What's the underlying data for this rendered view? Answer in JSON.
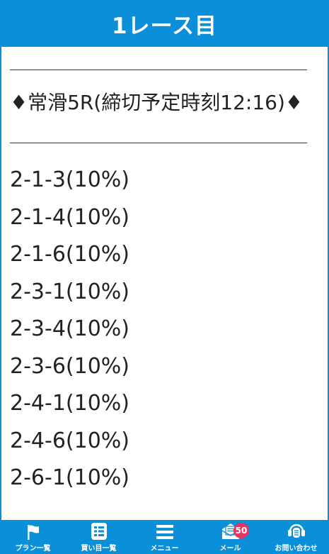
{
  "header": {
    "title": "1レース目"
  },
  "content": {
    "race_line": "♦常滑5R(締切予定時刻12:16)♦",
    "bets": [
      "2-1-3(10%)",
      "2-1-4(10%)",
      "2-1-6(10%)",
      "2-3-1(10%)",
      "2-3-4(10%)",
      "2-3-6(10%)",
      "2-4-1(10%)",
      "2-4-6(10%)",
      "2-6-1(10%)"
    ]
  },
  "footer": {
    "items": [
      {
        "label": "プラン一覧",
        "icon": "flag-icon"
      },
      {
        "label": "買い目一覧",
        "icon": "list-icon"
      },
      {
        "label": "メニュー",
        "icon": "menu-icon"
      },
      {
        "label": "メール",
        "icon": "mail-icon",
        "badge": "50"
      },
      {
        "label": "お問い合わせ",
        "icon": "headset-icon"
      }
    ]
  },
  "colors": {
    "accent": "#0a8fd8",
    "badge": "#e8335e"
  }
}
